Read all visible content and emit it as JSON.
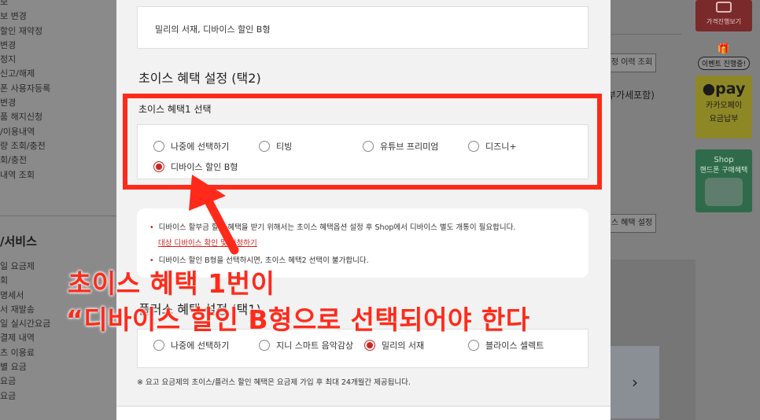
{
  "background": {
    "left_menu_top": [
      "보",
      "보 변경",
      "할인 재약정",
      "변경",
      "정지",
      "신고/해제",
      "폰 사용자등록",
      "변경",
      "품 해지신청",
      "/이용내역",
      "량 조회/충전",
      "회/충전",
      "내역 조회"
    ],
    "left_section_title": "/서비스",
    "left_menu_bottom": [
      "일 요금제",
      "회",
      "명세서",
      "서 재발송",
      "일 실시간요금",
      "결제 내역",
      "츠 이용료",
      "별 요금",
      "요금",
      "요금"
    ],
    "right_button_history": "정 이력 조회",
    "right_text_vat": "부가세포함)",
    "right_button_benefit": "스 혜택 설정",
    "right_arrow": "›"
  },
  "side_banners": {
    "top_label": "가격진행보기",
    "event_gift": "🎁",
    "event_label": "이벤트 진행중!",
    "pay_logo": "●pay",
    "pay_text_1": "카카오페이",
    "pay_text_2": "요금납부",
    "shop_title": "Shop",
    "shop_sub": "핸드폰 구매혜택"
  },
  "modal": {
    "selected_summary": "밀리의 서재, 디바이스 할인 B형",
    "choice_heading": "초이스 혜택 설정 (택2)",
    "choice1_heading": "초이스 혜택1 선택",
    "choice1_options": [
      {
        "label": "나중에 선택하기",
        "selected": false
      },
      {
        "label": "티빙",
        "selected": false
      },
      {
        "label": "유튜브 프리미엄",
        "selected": false
      },
      {
        "label": "디즈니+",
        "selected": false
      },
      {
        "label": "디바이스 할인 B형",
        "selected": true
      }
    ],
    "notice_1": "디바이스 할부금 할인 혜택을 받기 위해서는 초이스 혜택옵션 설정 후 Shop에서 디바이스 별도 개통이 필요합니다.",
    "notice_link": "대상 디바이스 확인 및 신청하기",
    "notice_2": "디바이스 할인 B형을 선택하시면, 초이스 혜택2 선택이 불가합니다.",
    "plus_heading": "플러스 혜택 설정 (택1)",
    "plus_options": [
      {
        "label": "나중에 선택하기",
        "selected": false
      },
      {
        "label": "지니 스마트 음악감상",
        "selected": false
      },
      {
        "label": "밀리의 서재",
        "selected": true
      },
      {
        "label": "블라이스 셀렉트",
        "selected": false
      }
    ],
    "footnote": "※ 요고 요금제의 초이스/플러스 할인 혜택은 요금제 가입 후 최대 24개월간 제공됩니다."
  },
  "annotation": {
    "line1": "초이스 혜택 1번이",
    "line2": "“디바이스 할인 B형으로 선택되어야 한다",
    "color": "#ff2a1a"
  }
}
